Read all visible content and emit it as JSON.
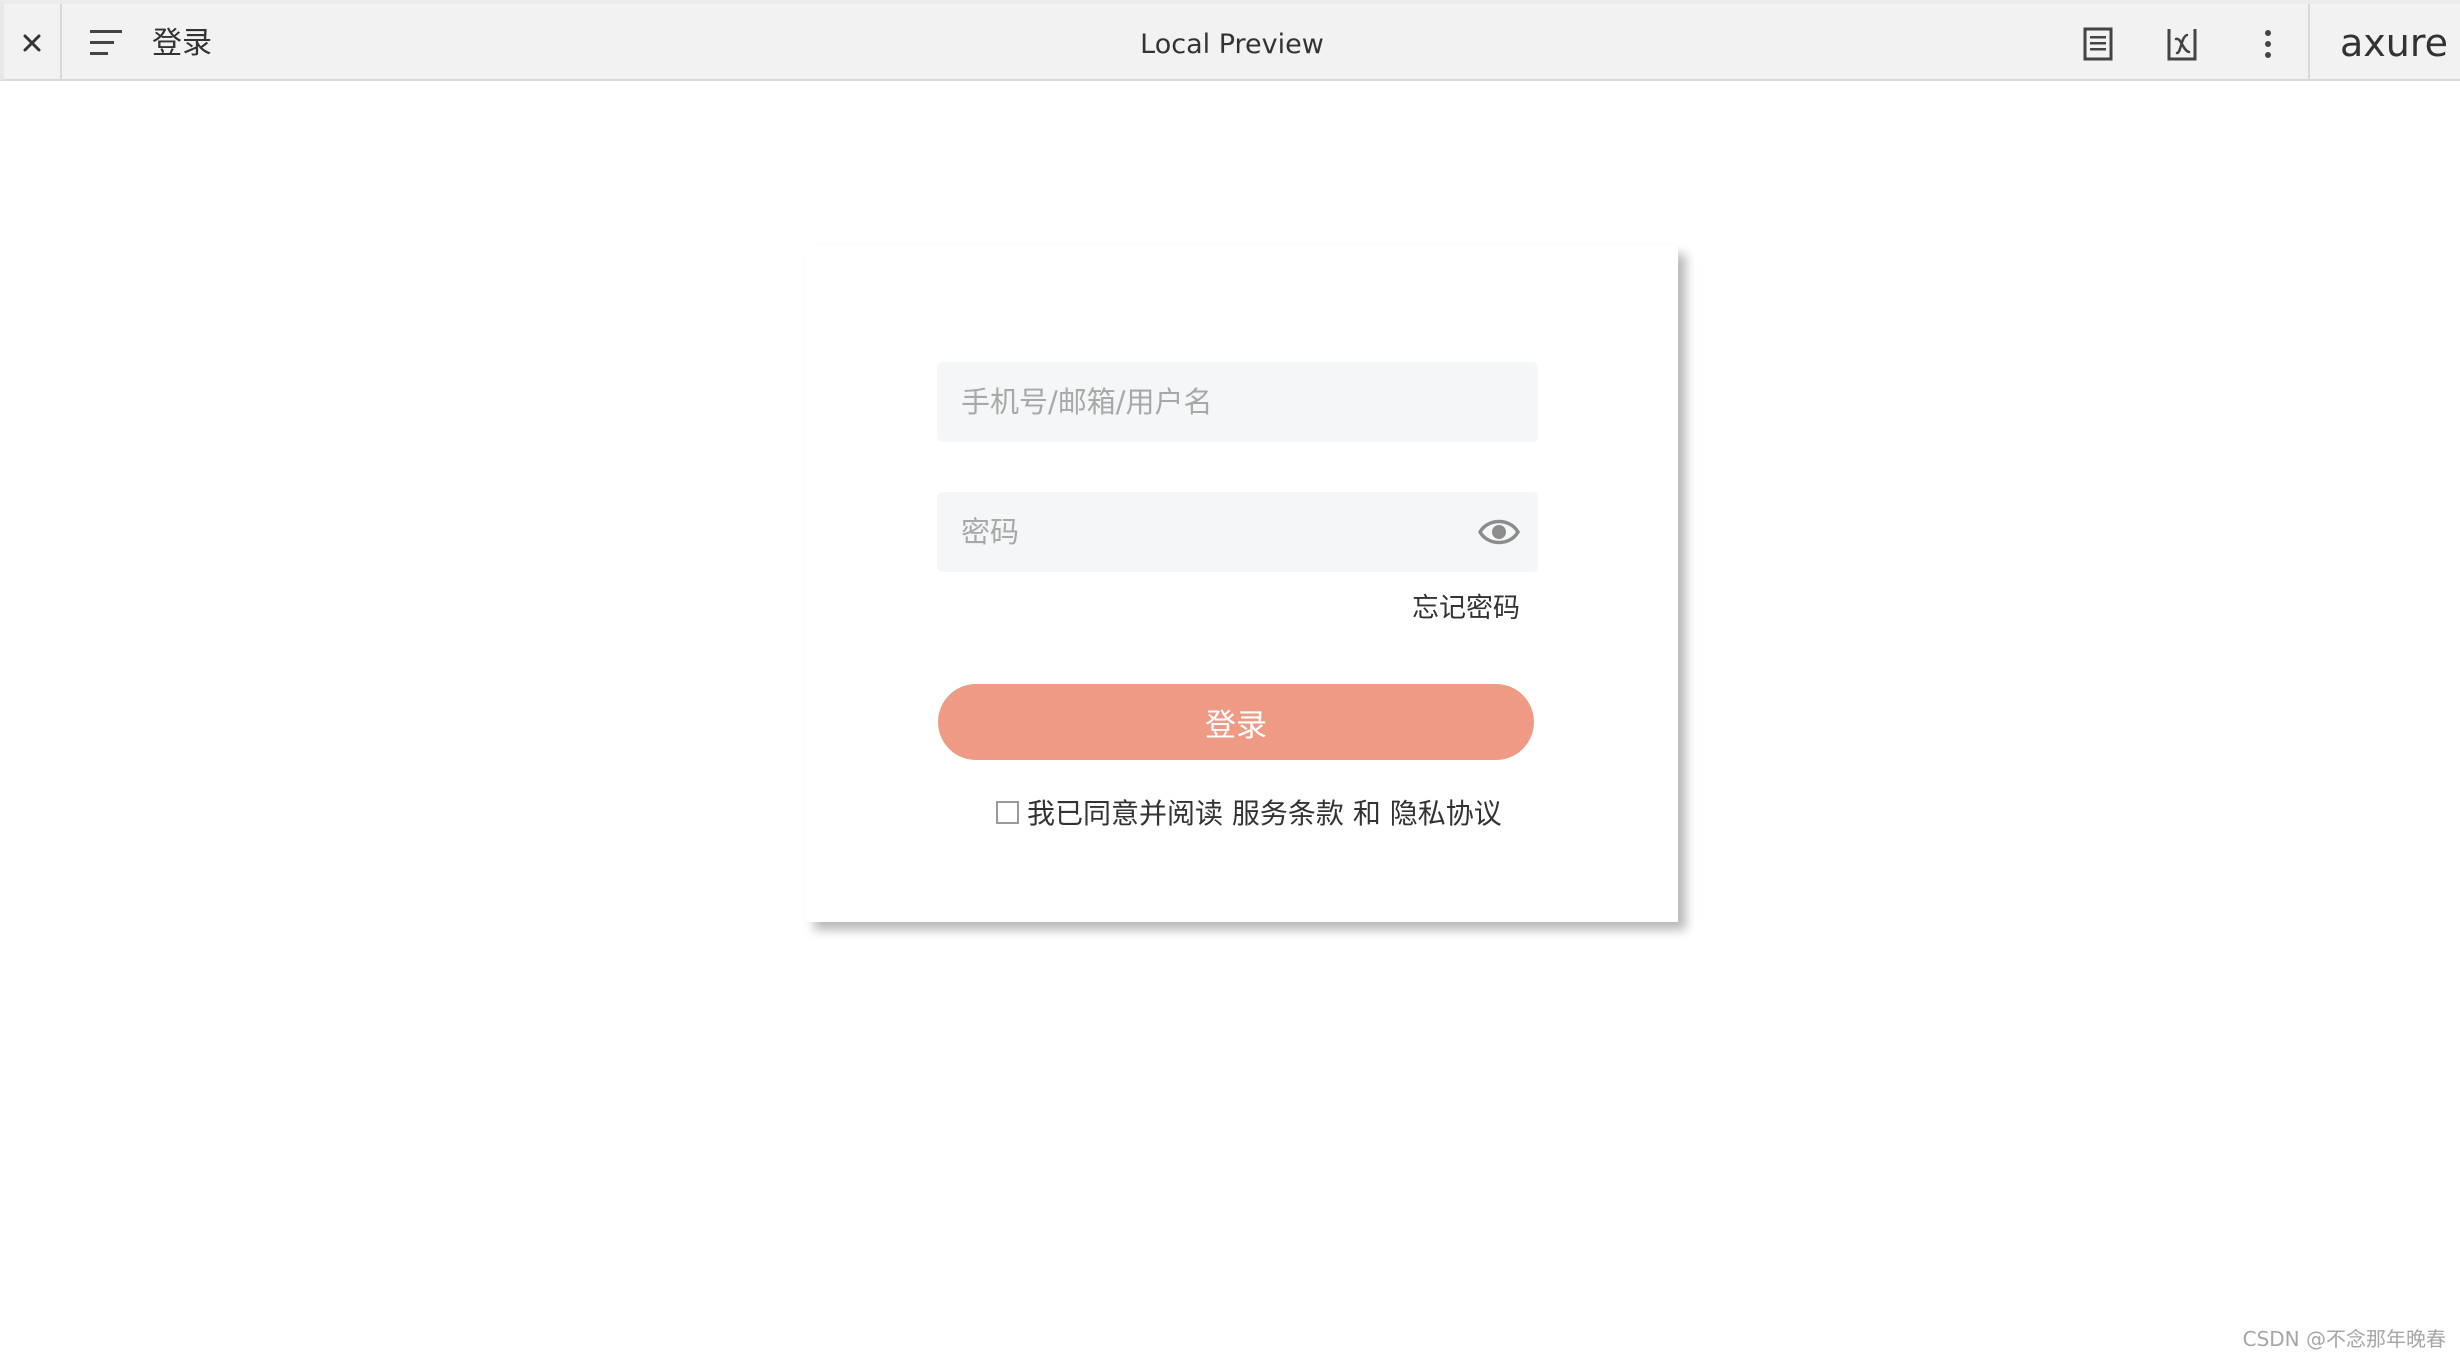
{
  "toolbar": {
    "close_icon": "close-icon",
    "menu_icon": "hamburger-menu-icon",
    "page_title": "登录",
    "center_title": "Local Preview",
    "notes_icon": "notes-document-icon",
    "variables_icon": "variables-x-icon",
    "more_icon": "more-vertical-icon",
    "logo_text": "axure"
  },
  "login": {
    "username_placeholder": "手机号/邮箱/用户名",
    "password_placeholder": "密码",
    "eye_icon": "eye-icon",
    "forgot_label": "忘记密码",
    "login_label": "登录",
    "agree_prefix": "我已同意并阅读 ",
    "terms_label": "服务条款",
    "and_label": " 和 ",
    "privacy_label": "隐私协议"
  },
  "watermark": "CSDN @不念那年晚春",
  "colors": {
    "accent": "#ee9a84",
    "field_bg": "#f5f6f7",
    "toolbar_bg": "#f2f2f2",
    "logo_x_pink": "#e5337f",
    "logo_x_cyan": "#2bb7d6"
  }
}
